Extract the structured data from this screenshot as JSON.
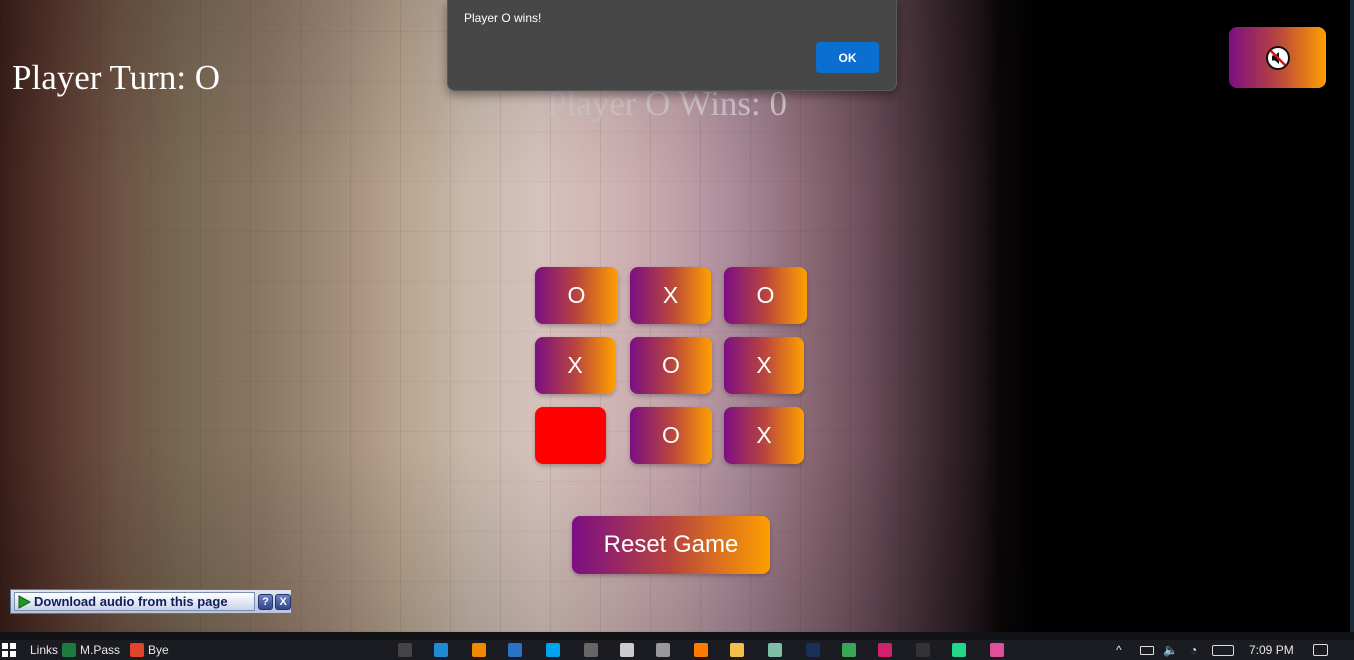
{
  "game": {
    "player_turn": "Player Turn: O",
    "wins_label": "Player O Wins: 0",
    "reset_label": "Reset Game",
    "mute_icon": "speaker-muted-icon",
    "board": [
      "O",
      "X",
      "O",
      "X",
      "O",
      "X",
      "",
      "O",
      "X"
    ],
    "highlight_cell": 7,
    "colors": {
      "gradient_start": "#7b0e84",
      "gradient_end": "#ff9f00",
      "highlight": "#ff0000"
    }
  },
  "dialog": {
    "message": "Player O wins!",
    "ok_label": "OK"
  },
  "extension_bar": {
    "label": "Download audio from this page",
    "help_label": "?",
    "close_label": "X"
  },
  "taskbar": {
    "links_label": "Links",
    "mpass_label": "M.Pass",
    "bye_label": "Bye",
    "time": "7:09 PM",
    "pinned_icons": [
      "terminal-icon",
      "edge-icon",
      "vlc-icon",
      "outlook-icon",
      "skype-icon",
      "keyboard-icon",
      "settings-icon",
      "media-player-icon",
      "sublime-icon",
      "file-explorer-icon",
      "chatgpt-icon",
      "photoshop-icon",
      "chrome-canary-icon",
      "app-cube-icon",
      "cmd-icon",
      "pycharm-icon",
      "app-colorful-icon"
    ]
  }
}
